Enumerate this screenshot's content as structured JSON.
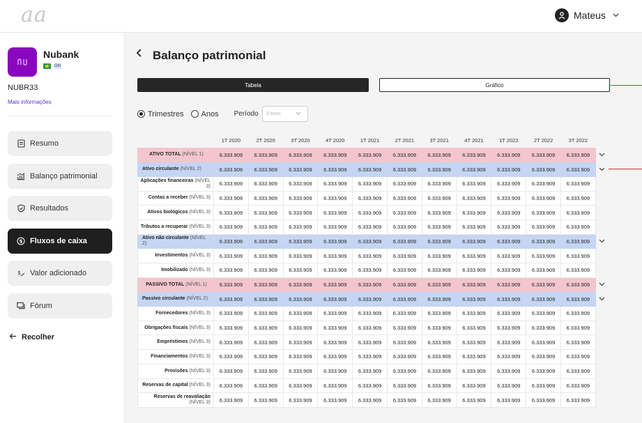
{
  "header": {
    "logo": "aa",
    "user_name": "Mateus"
  },
  "company": {
    "name": "Nubank",
    "flag_pill": "ON",
    "ticker": "NUBR33",
    "more_info": "Mais informações"
  },
  "sidebar": {
    "items": [
      {
        "label": "Resumo",
        "icon": "document-icon"
      },
      {
        "label": "Balanço patrimonial",
        "icon": "balance-chart-icon"
      },
      {
        "label": "Resultados",
        "icon": "shield-check-icon"
      },
      {
        "label": "Fluxos de caixa",
        "icon": "dollar-circle-icon"
      },
      {
        "label": "Valor adicionado",
        "icon": "value-add-icon"
      },
      {
        "label": "Fórum",
        "icon": "forum-icon"
      }
    ],
    "collapse_label": "Recolher"
  },
  "page": {
    "title": "Balanço patrimonial",
    "tabs": {
      "table": "Tabela",
      "chart": "Gráfico"
    },
    "filters": {
      "quarterly": "Trimestres",
      "yearly": "Anos",
      "period_label": "Período",
      "period_value": "3 anos"
    }
  },
  "table": {
    "columns": [
      "1T 2020",
      "2T 2020",
      "3T 2020",
      "4T 2020",
      "1T 2021",
      "2T 2021",
      "3T 2021",
      "4T 2021",
      "1T 2022",
      "2T 2022",
      "3T 2022"
    ],
    "cell_value": "6.333.909",
    "rows": [
      {
        "name": "ATIVO TOTAL",
        "level": "(NÍVEL 1)",
        "style": "pink",
        "expandable": true
      },
      {
        "name": "Ativo circulante",
        "level": "(NÍVEL 2)",
        "style": "blue",
        "expandable": true
      },
      {
        "name": "Aplicações financeiras",
        "level": "(NÍVEL 3)",
        "style": "white",
        "expandable": false
      },
      {
        "name": "Contas a receber",
        "level": "(NÍVEL 3)",
        "style": "white",
        "expandable": false
      },
      {
        "name": "Ativos biológicos",
        "level": "(NÍVEL 3)",
        "style": "white",
        "expandable": false
      },
      {
        "name": "Tributos a recuperar",
        "level": "(NÍVEL 3)",
        "style": "white",
        "expandable": false
      },
      {
        "name": "Ativo não circulante",
        "level": "(NÍVEL 2)",
        "style": "blue",
        "expandable": true
      },
      {
        "name": "Investimentos",
        "level": "(NÍVEL 3)",
        "style": "white",
        "expandable": false
      },
      {
        "name": "Imobilizado",
        "level": "(NÍVEL 3)",
        "style": "white",
        "expandable": false
      },
      {
        "name": "PASSIVO TOTAL",
        "level": "(NÍVEL 1)",
        "style": "pink",
        "expandable": true
      },
      {
        "name": "Passivo circulante",
        "level": "(NÍVEL 2)",
        "style": "blue",
        "expandable": true
      },
      {
        "name": "Fornecedores",
        "level": "(NÍVEL 3)",
        "style": "white",
        "expandable": false
      },
      {
        "name": "Obrigações fiscais",
        "level": "(NÍVEL 3)",
        "style": "white",
        "expandable": false
      },
      {
        "name": "Empréstimos",
        "level": "(NÍVEL 3)",
        "style": "white",
        "expandable": false
      },
      {
        "name": "Financiamentos",
        "level": "(NÍVEL 3)",
        "style": "white",
        "expandable": false
      },
      {
        "name": "Provisões",
        "level": "(NÍVEL 3)",
        "style": "white",
        "expandable": false
      },
      {
        "name": "Reservas de capital",
        "level": "(NÍVEL 3)",
        "style": "white",
        "expandable": false
      },
      {
        "name": "Reservas de reavaliação",
        "level": "(NÍVEL 3)",
        "style": "white",
        "expandable": false
      }
    ]
  },
  "colors": {
    "nubank_purple": "#8a05be",
    "row_level1": "#f2c6cc",
    "row_level2": "#c5d5f3",
    "annotation_red": "#d32f2f",
    "primary_dark": "#262626"
  }
}
